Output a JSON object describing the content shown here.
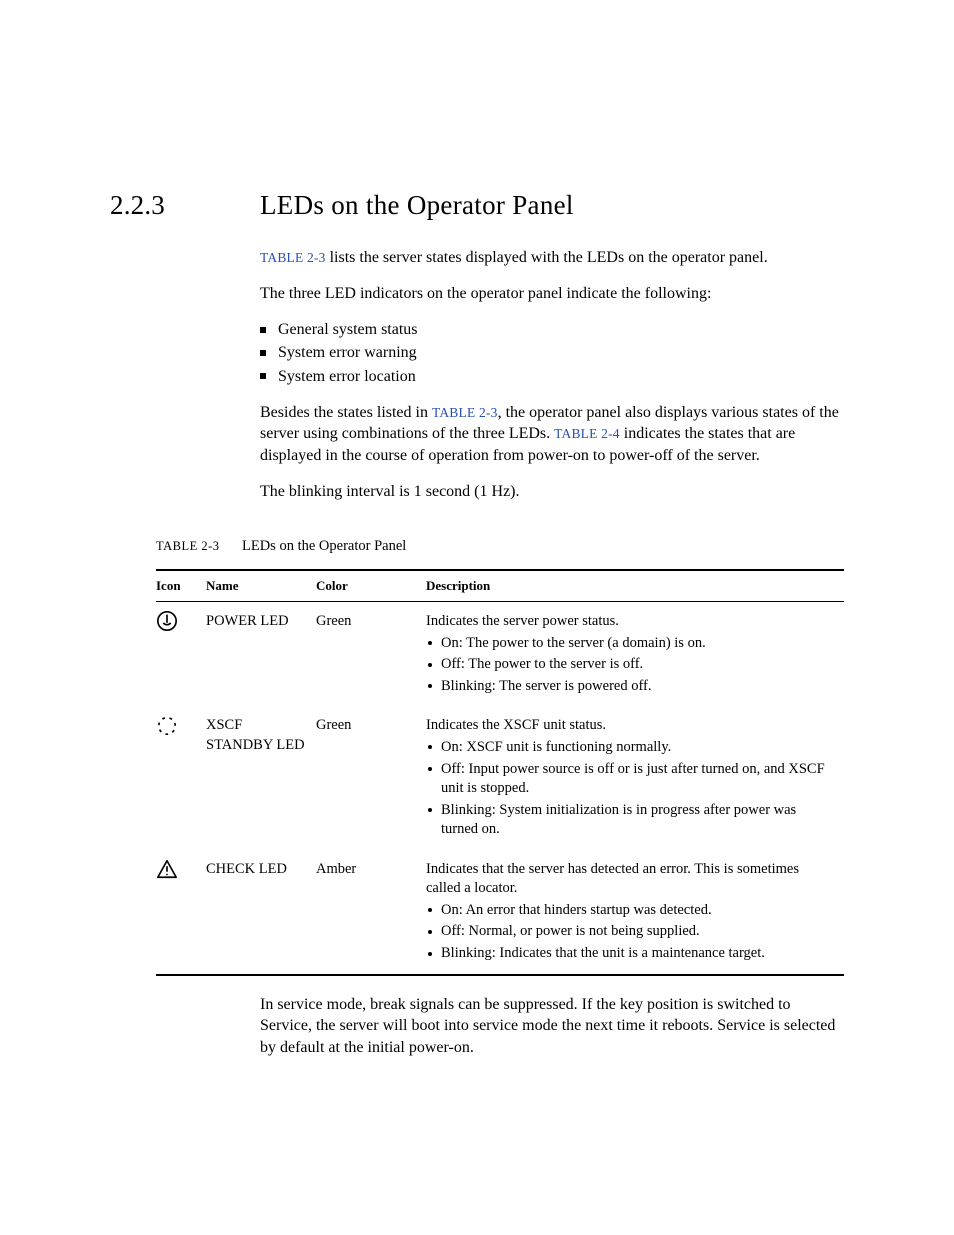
{
  "section": {
    "number": "2.2.3",
    "title": "LEDs on the Operator Panel"
  },
  "refs": {
    "t23": "TABLE 2-3",
    "t24": "TABLE 2-4"
  },
  "intro": {
    "p1a": " lists the server states displayed with the LEDs on the operator panel.",
    "p2": "The three LED indicators on the operator panel indicate the following:",
    "bullets": [
      "General system status",
      "System error warning",
      "System error location"
    ],
    "p3a": "Besides the states listed in ",
    "p3b": ", the operator panel also displays various states of the server using combinations of the three LEDs. ",
    "p3c": " indicates the states that are displayed in the course of operation from power-on to power-off of the server.",
    "p4": "The blinking interval is 1 second (1 Hz)."
  },
  "table": {
    "code": "TABLE 2-3",
    "caption": "LEDs on the Operator Panel",
    "headers": {
      "icon": "Icon",
      "name": "Name",
      "color": "Color",
      "desc": "Description"
    },
    "rows": [
      {
        "icon": "power",
        "name": "POWER LED",
        "color": "Green",
        "desc_intro": "Indicates the server power status.",
        "bullets": [
          "On: The power to the server (a domain) is on.",
          "Off: The power to the server is off.",
          "Blinking: The server is powered off."
        ]
      },
      {
        "icon": "standby",
        "name": "XSCF STANDBY LED",
        "color": "Green",
        "desc_intro": "Indicates the XSCF unit status.",
        "bullets": [
          "On: XSCF unit is functioning normally.",
          "Off: Input power source is off or is just after turned on, and XSCF unit is stopped.",
          "Blinking: System initialization is in progress after power was turned on."
        ]
      },
      {
        "icon": "check",
        "name": "CHECK LED",
        "color": "Amber",
        "desc_intro": "Indicates that the server has detected an error. This is sometimes called a locator.",
        "bullets": [
          "On: An error that hinders startup was detected.",
          "Off: Normal, or power is not being supplied.",
          "Blinking: Indicates that the unit is a maintenance target."
        ]
      }
    ]
  },
  "after": "In service mode, break signals can be suppressed. If the key position is switched to Service, the server will boot into service mode the next time it reboots. Service is selected by default at the initial power-on."
}
